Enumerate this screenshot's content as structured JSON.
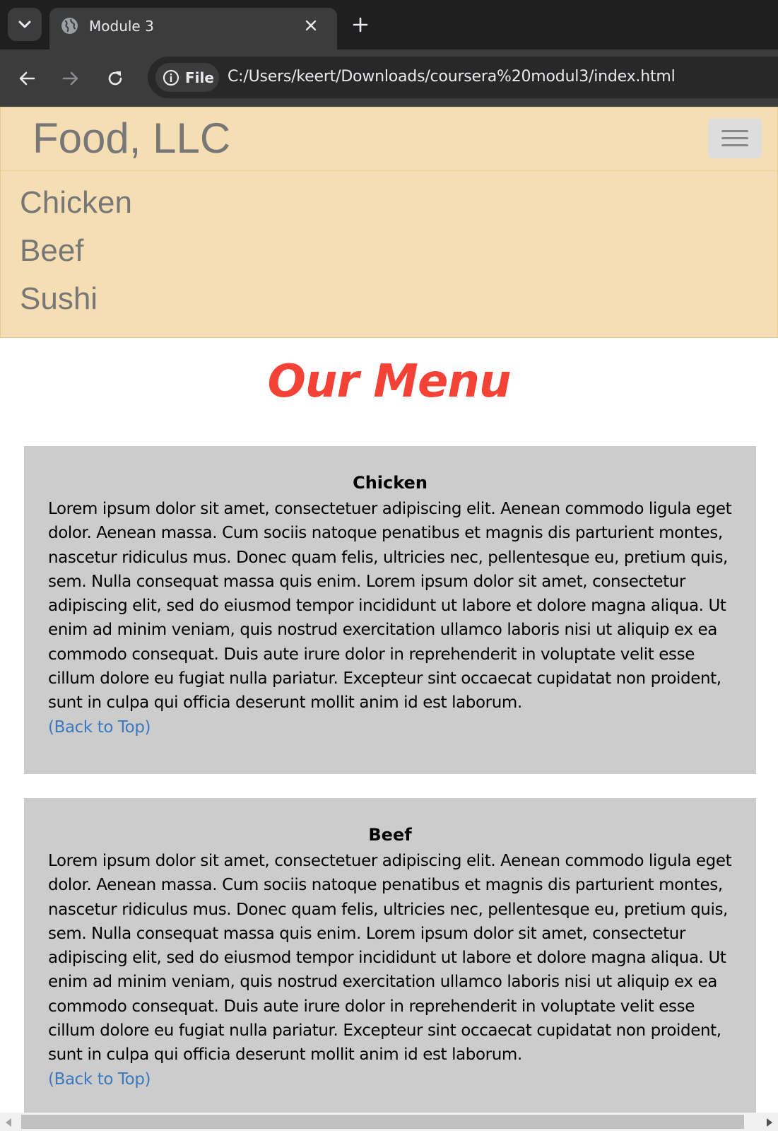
{
  "browser": {
    "tab": {
      "title": "Module 3",
      "icon": "globe-icon"
    },
    "address_bar": {
      "chip_label": "File",
      "url": "C:/Users/keert/Downloads/coursera%20modul3/index.html"
    }
  },
  "navbar": {
    "brand": "Food, LLC",
    "items": [
      "Chicken",
      "Beef",
      "Sushi"
    ],
    "background_color": "#f5deb3"
  },
  "page": {
    "title": "Our Menu",
    "title_color": "#f44336",
    "sections": [
      {
        "heading": "Chicken",
        "body": "Lorem ipsum dolor sit amet, consectetuer adipiscing elit. Aenean commodo ligula eget dolor. Aenean massa. Cum sociis natoque penatibus et magnis dis parturient montes, nascetur ridiculus mus. Donec quam felis, ultricies nec, pellentesque eu, pretium quis, sem. Nulla consequat massa quis enim. Lorem ipsum dolor sit amet, consectetur adipiscing elit, sed do eiusmod tempor incididunt ut labore et dolore magna aliqua. Ut enim ad minim veniam, quis nostrud exercitation ullamco laboris nisi ut aliquip ex ea commodo consequat. Duis aute irure dolor in reprehenderit in voluptate velit esse cillum dolore eu fugiat nulla pariatur. Excepteur sint occaecat cupidatat non proident, sunt in culpa qui officia deserunt mollit anim id est laborum.",
        "link": "(Back to Top)"
      },
      {
        "heading": "Beef",
        "body": "Lorem ipsum dolor sit amet, consectetuer adipiscing elit. Aenean commodo ligula eget dolor. Aenean massa. Cum sociis natoque penatibus et magnis dis parturient montes, nascetur ridiculus mus. Donec quam felis, ultricies nec, pellentesque eu, pretium quis, sem. Nulla consequat massa quis enim. Lorem ipsum dolor sit amet, consectetur adipiscing elit, sed do eiusmod tempor incididunt ut labore et dolore magna aliqua. Ut enim ad minim veniam, quis nostrud exercitation ullamco laboris nisi ut aliquip ex ea commodo consequat. Duis aute irure dolor in reprehenderit in voluptate velit esse cillum dolore eu fugiat nulla pariatur. Excepteur sint occaecat cupidatat non proident, sunt in culpa qui officia deserunt mollit anim id est laborum.",
        "link": "(Back to Top)"
      }
    ]
  }
}
